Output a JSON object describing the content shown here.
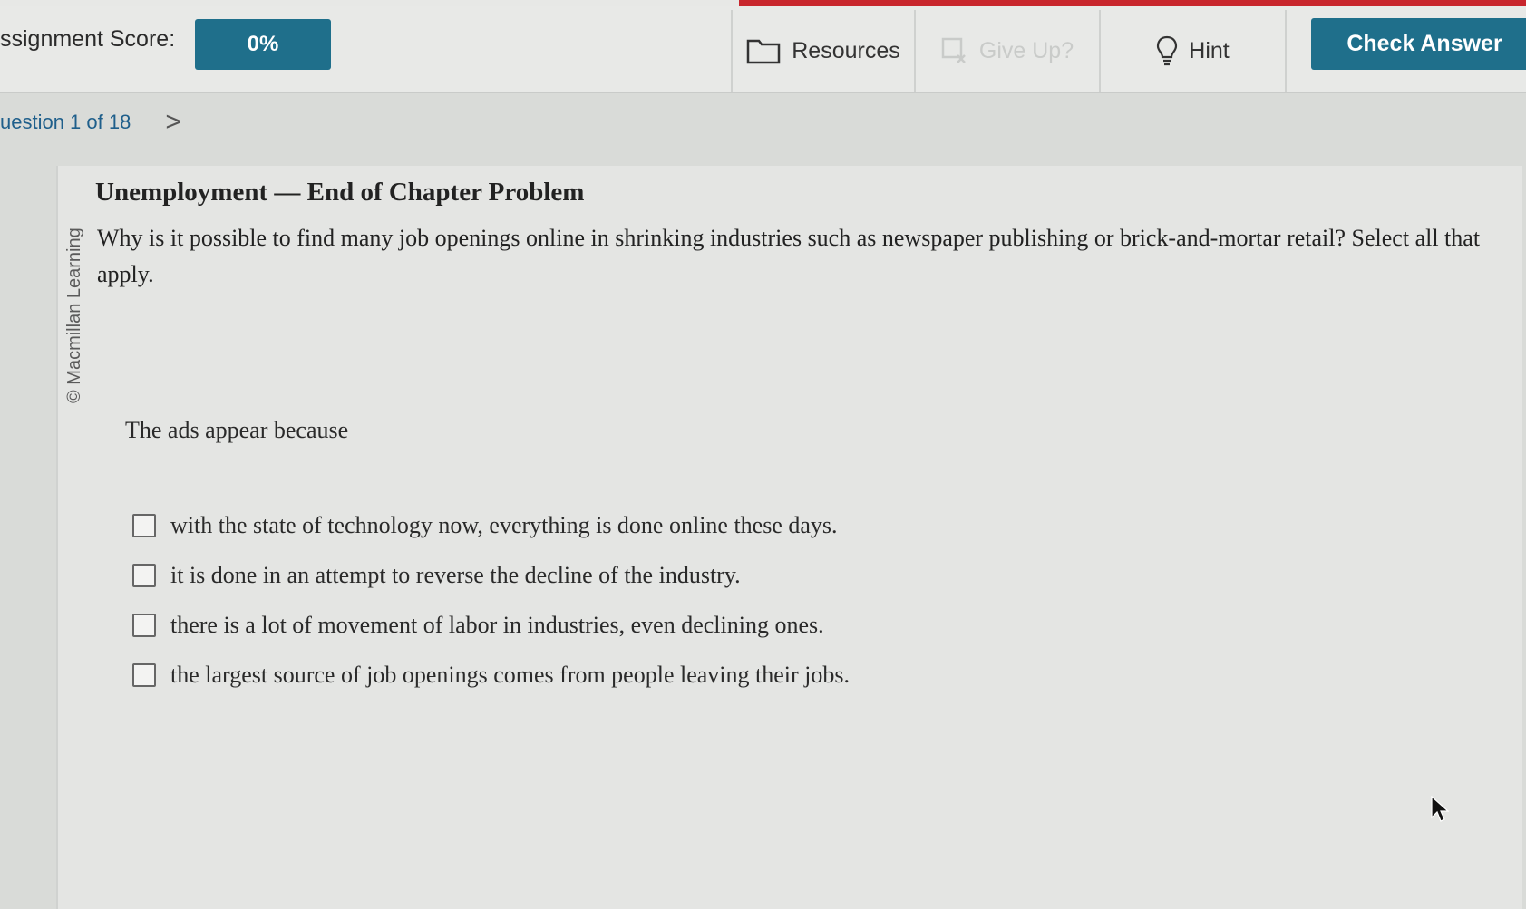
{
  "toolbar": {
    "score_label": "ssignment Score:",
    "score_value": "0%",
    "resources_label": "Resources",
    "give_up_label": "Give Up?",
    "hint_label": "Hint",
    "check_answer_label": "Check Answer"
  },
  "navigation": {
    "question_counter": "uestion 1 of 18",
    "next_chevron": ">"
  },
  "problem": {
    "copyright": "© Macmillan Learning",
    "title": "Unemployment — End of Chapter Problem",
    "question": "Why is it possible to find many job openings online in shrinking industries such as newspaper publishing or brick-and-mortar retail? Select all that apply.",
    "prompt": "The ads appear because",
    "options": [
      {
        "label": "with the state of technology now, everything is done online these days.",
        "checked": false
      },
      {
        "label": "it is done in an attempt to reverse the decline of the industry.",
        "checked": false
      },
      {
        "label": "there is a lot of movement of labor in industries, even declining ones.",
        "checked": false
      },
      {
        "label": "the largest source of job openings comes from people leaving their jobs.",
        "checked": false
      }
    ]
  },
  "colors": {
    "accent": "#1f6f8b",
    "top_bar": "#c8262d",
    "link": "#1f5f8b"
  },
  "icons": {
    "resources": "folder-icon",
    "give_up": "give-up-icon",
    "hint": "lightbulb-icon",
    "cursor": "mouse-pointer-icon"
  }
}
